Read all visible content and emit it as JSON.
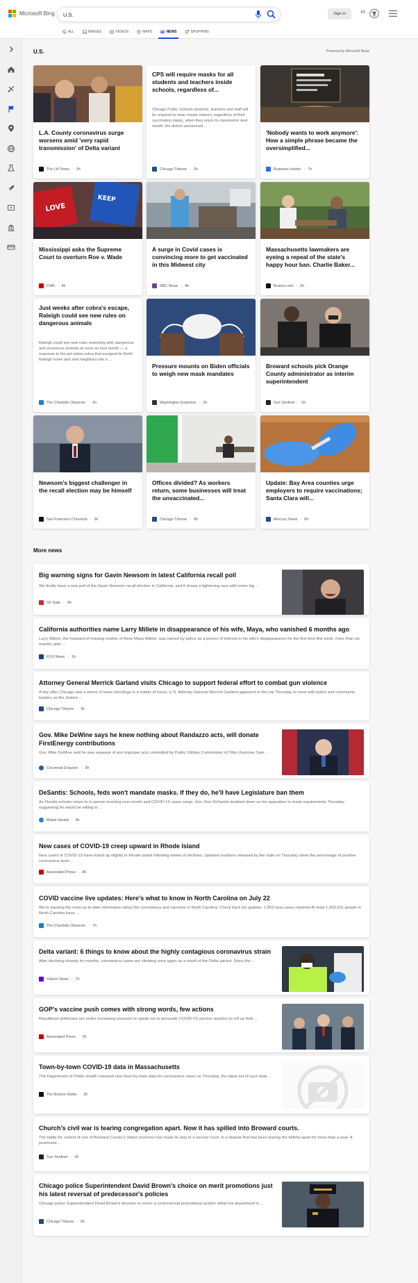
{
  "header": {
    "logo_text": "Microsoft Bing",
    "search_value": "U.S.",
    "signin_label": "Sign in",
    "points": "10"
  },
  "nav": {
    "tabs": [
      {
        "label": "ALL",
        "icon": "search-icon"
      },
      {
        "label": "IMAGES",
        "icon": "image-icon"
      },
      {
        "label": "VIDEOS",
        "icon": "video-icon"
      },
      {
        "label": "MAPS",
        "icon": "map-pin-icon"
      },
      {
        "label": "NEWS",
        "icon": "news-icon",
        "active": true
      },
      {
        "label": "SHOPPING",
        "icon": "shopping-tag-icon"
      }
    ]
  },
  "sidebar": {
    "icons": [
      "expand-chevron-icon",
      "home-icon",
      "sports-icon",
      "flag-icon",
      "location-pin-icon",
      "globe-icon",
      "science-icon",
      "technology-rocket-icon",
      "entertainment-icon",
      "politics-building-icon",
      "money-icon"
    ]
  },
  "section": {
    "title": "U.S.",
    "powered_by": "Powered by Microsoft News"
  },
  "cards": [
    {
      "title": "L.A. County coronavirus surge worsens amid 'very rapid transmission' of Delta variant",
      "source": "The LA Times",
      "time": "3h",
      "has_image": true
    },
    {
      "title": "CPS will require masks for all students and teachers inside schools, regardless of...",
      "snippet": "Chicago Public Schools students, teachers and staff will be required to wear masks indoors, regardless of their vaccination status, when they return to classrooms next month, the district announced ...",
      "source": "Chicago Tribune",
      "time": "2h",
      "has_image": false
    },
    {
      "title": "'Nobody wants to work anymore': How a simple phrase became the oversimplified...",
      "source": "Business Insider",
      "time": "7h",
      "has_image": true
    },
    {
      "title": "Mississippi asks the Supreme Court to overturn Roe v. Wade",
      "source": "CNN",
      "time": "4h",
      "has_image": true
    },
    {
      "title": "A surge in Covid cases is convincing more to get vaccinated in this Midwest city",
      "source": "NBC News",
      "time": "4h",
      "has_image": true
    },
    {
      "title": "Massachusetts lawmakers are eyeing a repeal of the state's happy hour ban. Charlie Baker...",
      "source": "Boston.com",
      "time": "2h",
      "has_image": true
    },
    {
      "title": "Just weeks after cobra's escape, Raleigh could see new rules on dangerous animals",
      "snippet": "Raleigh could see new rules restricting wild, dangerous and venomous animals as soon as next month — a response to the pet zebra cobra that escaped its North Raleigh home and sent neighbors into a ...",
      "source": "The Charlotte Observer",
      "time": "2h",
      "has_image": false
    },
    {
      "title": "Pressure mounts on Biden officials to weigh new mask mandates",
      "source": "Washington Examiner",
      "time": "2h",
      "has_image": true
    },
    {
      "title": "Broward schools pick Orange County administrator as interim superintendent",
      "source": "Sun Sentinel",
      "time": "5h",
      "has_image": true
    },
    {
      "title": "Newsom's biggest challenger in the recall election may be himself",
      "source": "San Francisco Chronicle",
      "time": "3h",
      "has_image": true
    },
    {
      "title": "Offices divided? As workers return, some businesses will treat the unvaccinated...",
      "source": "Chicago Tribune",
      "time": "6h",
      "has_image": true
    },
    {
      "title": "Update: Bay Area counties urge employers to require vaccinations; Santa Clara will...",
      "source": "Mercury News",
      "time": "6h",
      "has_image": true
    }
  ],
  "more_news": {
    "title": "More news",
    "items": [
      {
        "title": "Big warning signs for Gavin Newsom in latest California recall poll",
        "snippet": "We finally have a new poll of the Gavin Newsom recall election in California, and it shows a tightening race with some big ...",
        "source": "SF Gate",
        "time": "9h",
        "has_image": true
      },
      {
        "title": "California authorities name Larry Millete in disappearance of his wife, Maya, who vanished 6 months ago",
        "snippet": "Larry Millete, the husband of missing mother of three Maya Millete, was named by police as a person of interest in his wife's disappearance for the first time this week, more than six months after ...",
        "source": "FOX News",
        "time": "1h",
        "has_image": false
      },
      {
        "title": "Attorney General Merrick Garland visits Chicago to support federal effort to combat gun violence",
        "snippet": "A day after Chicago saw a series of mass shootings in a matter of hours, U.S. Attorney General Merrick Garland appeared in the city Thursday to meet with police and community leaders as the Justice ...",
        "source": "Chicago Tribune",
        "time": "3h",
        "has_image": false
      },
      {
        "title": "Gov. Mike DeWine says he knew nothing about Randazzo acts, will donate FirstEnergy contributions",
        "snippet": "Gov. Mike DeWine said he was unaware of any improper acts committed by Public Utilities Commission of Ohio chairman Sam ...",
        "source": "Cincinnati Enquirer",
        "time": "3h",
        "has_image": true
      },
      {
        "title": "DeSantis: Schools, feds won't mandate masks. If they do, he'll have Legislature ban them",
        "snippet": "As Florida schools return to in-person learning next month and COVID-19 cases surge, Gov. Ron DeSantis doubled down on his opposition to mask requirements Thursday, suggesting he would be willing to ...",
        "source": "Miami Herald",
        "time": "4h",
        "has_image": false
      },
      {
        "title": "New cases of COVID-19 creep upward in Rhode Island",
        "snippet": "New cases of COVID-19 have ticked up slightly in Rhode Island following weeks of declines. Updated numbers released by the state on Thursday show the percentage of positive coronavirus tests ...",
        "source": "Associated Press",
        "time": "8h",
        "has_image": false
      },
      {
        "title": "COVID vaccine live updates: Here's what to know in North Carolina on July 22",
        "snippet": "We're tracking the most up-to-date information about the coronavirus and vaccines in North Carolina. Check back for updates. 1,800 new cases reported At least 1,029,931 people in North Carolina have ...",
        "source": "The Charlotte Observer",
        "time": "7h",
        "has_image": false
      },
      {
        "title": "Delta variant: 6 things to know about the highly contagious coronavirus strain",
        "snippet": "After declining sharply for months, coronavirus cases are climbing once again as a result of the Delta variant. Since the ...",
        "source": "Yahoo! News",
        "time": "7h",
        "has_image": true
      },
      {
        "title": "GOP's vaccine push comes with strong words, few actions",
        "snippet": "Republican politicians are under increasing pressure to speak out to persuade COVID-19 vaccine skeptics to roll up their ...",
        "source": "Associated Press",
        "time": "2h",
        "has_image": true
      },
      {
        "title": "Town-by-town COVID-19 data in Massachusetts",
        "snippet": "The Department of Public Health released new town-by-town data for coronavirus cases on Thursday, the latest set of such data ...",
        "source": "The Boston Globe",
        "time": "3h",
        "has_image": true
      },
      {
        "title": "Church's civil war is tearing congregation apart. Now it has spilled into Broward courts.",
        "snippet": "The battle for control of one of Broward County's oldest churches has made its way to a secular court, in a dispute that has been tearing the faithful apart for more than a year. A prominent ...",
        "source": "Sun Sentinel",
        "time": "3h",
        "has_image": false
      },
      {
        "title": "Chicago police Superintendent David Brown's choice on merit promotions just his latest reversal of predecessor's policies",
        "snippet": "Chicago police Superintendent David Brown's decision to revive a controversial promotional system within his department is ...",
        "source": "Chicago Tribune",
        "time": "6h",
        "has_image": true
      }
    ]
  },
  "colors": {
    "accent": "#174ae4",
    "ms_red": "#f25022",
    "ms_green": "#7fba00",
    "ms_blue": "#00a4ef",
    "ms_yellow": "#ffb900"
  }
}
